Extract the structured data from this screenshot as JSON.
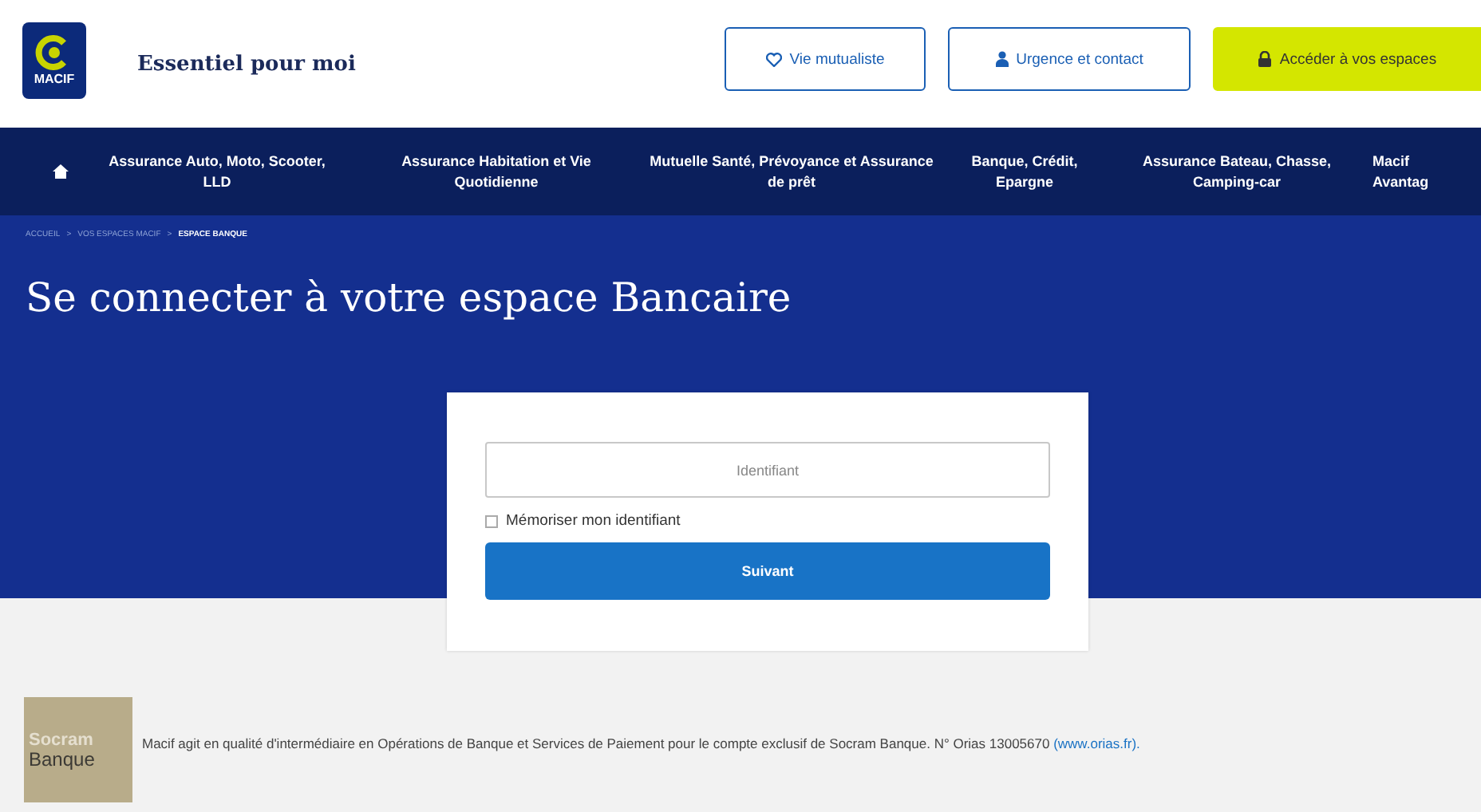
{
  "header": {
    "logo_text": "MACIF",
    "tagline": "Essentiel pour moi",
    "buttons": [
      {
        "label": "Vie mutualiste",
        "kind": "outline"
      },
      {
        "label": "Urgence et contact",
        "kind": "outline"
      },
      {
        "label": "Accéder à vos espaces",
        "kind": "primary"
      }
    ]
  },
  "nav": {
    "items": [
      "Assurance Auto, Moto, Scooter, LLD",
      "Assurance Habitation et Vie Quotidienne",
      "Mutuelle Santé, Prévoyance et Assurance de prêt",
      "Banque, Crédit, Epargne",
      "Assurance Bateau, Chasse, Camping-car",
      "Macif Avantag"
    ]
  },
  "breadcrumb": [
    {
      "label": "ACCUEIL",
      "current": false
    },
    {
      "separator": ">",
      "label": "VOS ESPACES MACIF",
      "current": false
    },
    {
      "separator": ">",
      "label": "ESPACE BANQUE",
      "current": true
    }
  ],
  "title": "Se connecter à votre espace Bancaire",
  "login": {
    "placeholder": "Identifiant",
    "remember": {
      "label": "Mémoriser mon identifiant",
      "checked": false
    },
    "submit": "Suivant"
  },
  "footer": {
    "logo_lines": [
      "Socram",
      "Banque"
    ],
    "text": "Macif agit en qualité d'intermédiaire en Opérations de Banque et Services de Paiement pour le compte exclusif de Socram Banque. N° Orias 13005670",
    "link": "(www.orias.fr)."
  }
}
